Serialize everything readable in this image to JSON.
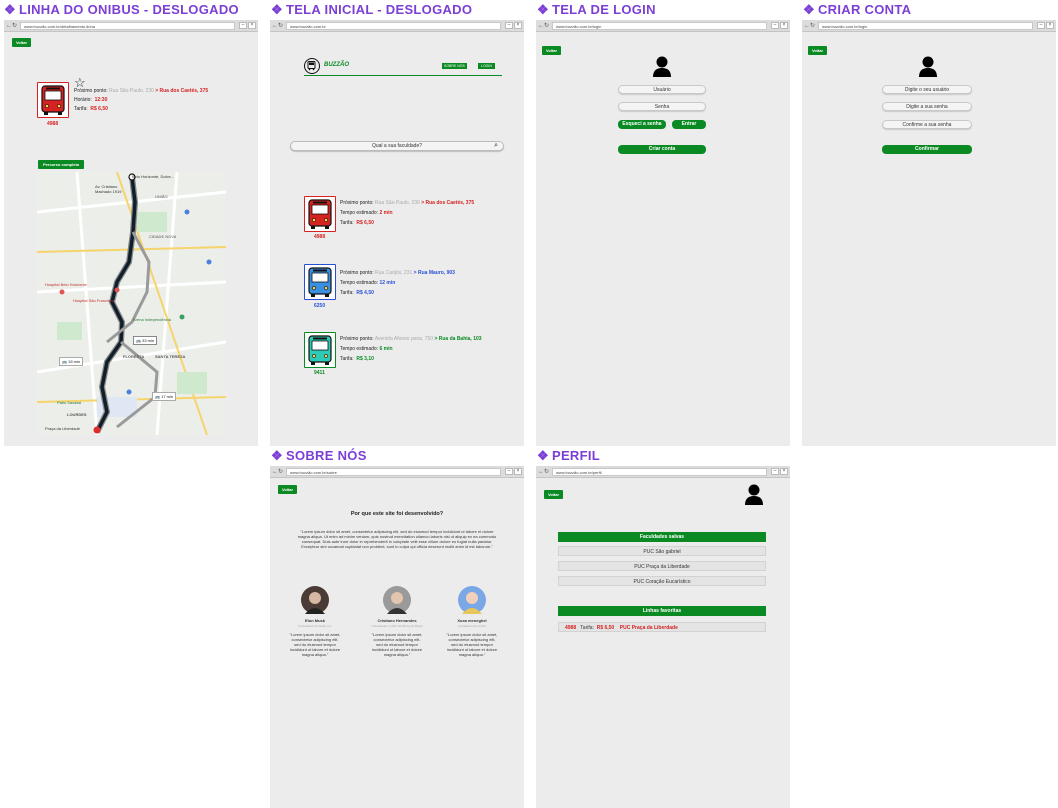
{
  "frames": {
    "linha": {
      "title": "LINHA DO ONIBUS - DESLOGADO",
      "url": "www.buzzão.com.br/detalhamento-linha",
      "voltar": "Voltar",
      "bus_number": "4988",
      "prox_label": "Próximo ponto:",
      "prox_from": "Rua São Paulo, 230",
      "prox_to": "> Rua dos Caetés, 375",
      "horario_label": "Horário:",
      "horario_value": "12:30",
      "tarifa_label": "Tarifa:",
      "tarifa_value": "R$ 6,50",
      "percurso_button": "Percurso completo",
      "map": {
        "labels": [
          "Av. Cristiano Machado 1919",
          "Belo Horizonte, Dolce...",
          "UNIÃO",
          "FLORESTA",
          "SANTA TEREZA",
          "LOURDES",
          "CIDADE NOVA",
          "Hospital Belo Horizonte",
          "Hospital São Francisco",
          "Arena Independência",
          "Pátio Savassi",
          "Praça da Liberdade"
        ],
        "time_badges": [
          "33 min",
          "15 min",
          "17 min"
        ]
      }
    },
    "inicial": {
      "title": "TELA INICIAL - DESLOGADO",
      "url": "www.buzzão.com.br",
      "brand": "BUZZÃO",
      "nav": [
        "SOBRE NÓS",
        "LOGIN"
      ],
      "search_placeholder": "Qual a sua faculdade?",
      "buses": [
        {
          "number": "4988",
          "prox_label": "Próximo ponto:",
          "from": "Rua São Paulo, 230",
          "to": "> Rua dos Caetés, 375",
          "tempo_label": "Tempo estimado:",
          "tempo": "2 min",
          "tarifa_label": "Tarifa:",
          "tarifa": "R$ 6,50",
          "color": "#d62222"
        },
        {
          "number": "6250",
          "prox_label": "Próximo ponto:",
          "from": "Rua Carijós, 231",
          "to": "> Rua Mauro, 903",
          "tempo_label": "Tempo estimado:",
          "tempo": "12 min",
          "tarifa_label": "Tarifa:",
          "tarifa": "R$ 4,50",
          "color": "#2a4fd6"
        },
        {
          "number": "9411",
          "prox_label": "Próximo ponto:",
          "from": "Avenida Afonso pena, 750",
          "to": "> Rua da Bahia, 103",
          "tempo_label": "Tempo estimado:",
          "tempo": "6 min",
          "tarifa_label": "Tarifa:",
          "tarifa": "R$ 3,10",
          "color": "#0b8a24"
        }
      ]
    },
    "login": {
      "title": "TELA DE LOGIN",
      "url": "www.buzzão.com.br/login",
      "voltar": "Voltar",
      "usuario": "Usuário",
      "senha": "Senha",
      "esqueci": "Esqueci a senha",
      "entrar": "Entrar",
      "criar": "Criar conta"
    },
    "criar": {
      "title": "CRIAR CONTA",
      "url": "www.buzzão.com.br/login",
      "voltar": "Voltar",
      "usuario": "Digite o seu usuário",
      "senha": "Digite a sua senha",
      "confirme": "Confirme a sua senha",
      "confirmar": "Confirmar"
    },
    "sobre": {
      "title": "SOBRE NÓS",
      "url": "www.buzzão.com.br/sobre",
      "voltar": "Voltar",
      "heading": "Por que este site foi desenvolvido?",
      "paragraph": "\"Lorem ipsum dolor sit amet, consectetur adipiscing elit, sed do eiusmod tempor incididunt ut labore et dolore magna aliqua. Ut enim ad minim veniam, quis nostrud exercitation ullamco laboris nisi ut aliquip ex ea commodo consequat. Duis aute irure dolor in reprehenderit in voluptate velit esse cillum dolore eu fugiat nulla pariatur. Excepteur sint occaecat cupidatat non proident, sunt in culpa qui officia deserunt mollit anim id est laborum.\"",
      "people": [
        {
          "name": "Elon Musk",
          "role": "Cofundador da Tesla, Inc.",
          "bio": "\"Lorem ipsum dolor sit amet, consectetur adipiscing elit, sed do eiusmod tempor incididunt ut labore et dolore magna aliqua.\""
        },
        {
          "name": "Cristiano Hernandes",
          "role": "Cofundador e CEO da Microsoft Brasil",
          "bio": "\"Lorem ipsum dolor sit amet, consectetur adipiscing elit, sed do eiusmod tempor incididunt ut labore et dolore magna aliqua.\""
        },
        {
          "name": "Xuxa meneghel",
          "role": "Fundadora da XUXA",
          "bio": "\"Lorem ipsum dolor sit amet, consectetur adipiscing elit, sed do eiusmod tempor incididunt ut labore et dolore magna aliqua.\""
        }
      ]
    },
    "perfil": {
      "title": "PERFIL",
      "url": "www.buzzão.com.br/perfil",
      "voltar": "Voltar",
      "faculdades_head": "Faculdades salvas",
      "faculdades": [
        "PUC São gabriel",
        "PUC Praça da Liberdade",
        "PUC Coração Eucarístico"
      ],
      "linhas_head": "Linhas favoritas",
      "linha_num": "4988",
      "linha_tarifa_label": "Tarifa:",
      "linha_tarifa": "R$ 6,50",
      "linha_dest": "PUC Praça da Liberdade"
    }
  },
  "colors": {
    "title": "#7b3fd6",
    "green": "#0b8a24",
    "red": "#d62222",
    "blue": "#2a4fd6",
    "frame_bg": "#ececec"
  }
}
